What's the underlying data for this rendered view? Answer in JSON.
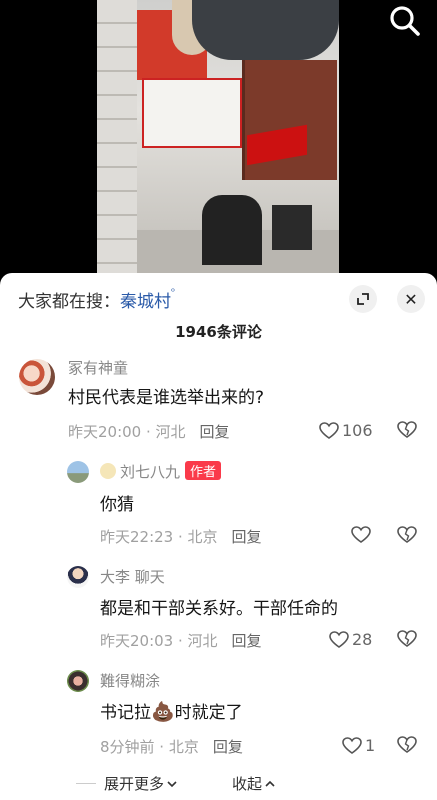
{
  "search": {
    "icon": "search-icon"
  },
  "hot_search": {
    "prefix": "大家都在搜：",
    "keyword": "秦城村"
  },
  "comment_count": "1946条评论",
  "actions": {
    "expand_icon": "expand-icon",
    "close_label": "✕"
  },
  "comments": [
    {
      "username": "冢有神童",
      "text": "村民代表是谁选举出来的?",
      "time_location": "昨天20:00 · 河北",
      "reply": "回复",
      "likes": "106"
    },
    {
      "username": "刘七八九",
      "author_tag": "作者",
      "text": "你猜",
      "time_location": "昨天22:23 · 北京",
      "reply": "回复",
      "likes": ""
    },
    {
      "username": "大李 聊天",
      "text": "都是和干部关系好。干部任命的",
      "time_location": "昨天20:03 · 河北",
      "reply": "回复",
      "likes": "28"
    },
    {
      "username": "難得糊涂",
      "text_before": "书记拉",
      "text_emoji": "💩",
      "text_after": "时就定了",
      "time_location": "8分钟前 · 北京",
      "reply": "回复",
      "likes": "1"
    }
  ],
  "footer": {
    "more": "展开更多",
    "collapse": "收起"
  }
}
